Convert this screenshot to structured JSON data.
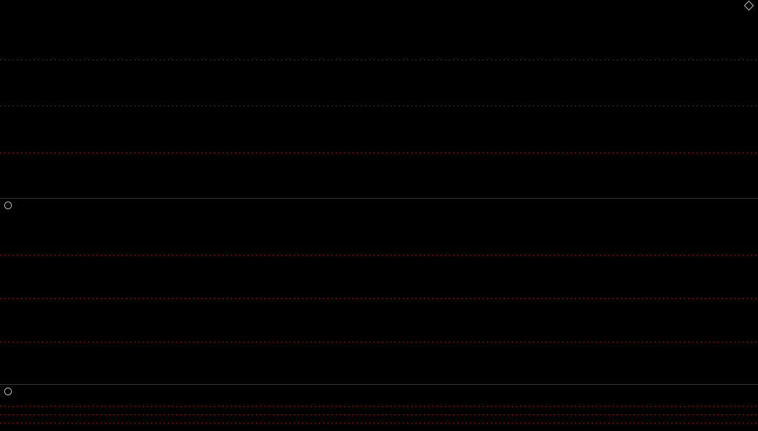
{
  "chart_data": [
    {
      "type": "line",
      "title": "",
      "series": []
    },
    {
      "type": "line",
      "title": "",
      "series": []
    },
    {
      "type": "bar",
      "title": "",
      "series": []
    }
  ],
  "colors": {
    "up": "#ff3b3b",
    "down": "#54ffff",
    "grid": "#8a1010",
    "bg": "#000000"
  },
  "icons": [
    "collapse-icon",
    "expand-icon"
  ]
}
